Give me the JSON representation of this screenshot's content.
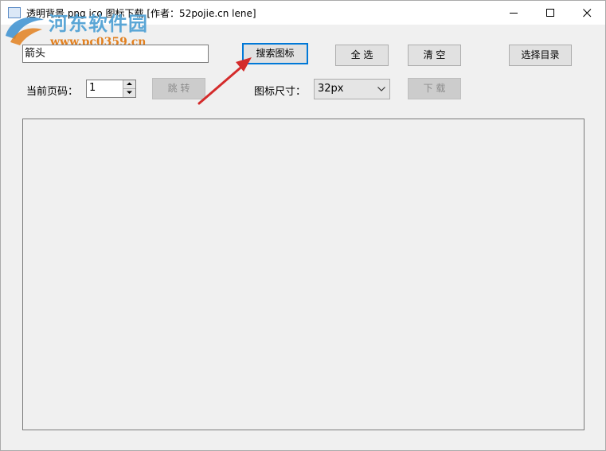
{
  "window": {
    "title": "透明背景 png ico 图标下载 [作者：52pojie.cn lene]"
  },
  "watermark": {
    "title": "河东软件园",
    "url": "www.pc0359.cn"
  },
  "search": {
    "value": "箭头"
  },
  "buttons": {
    "search": "搜索图标",
    "select_all": "全 选",
    "clear": "清 空",
    "choose_dir": "选择目录",
    "jump": "跳 转",
    "download": "下 载"
  },
  "pager": {
    "label": "当前页码：",
    "value": "1"
  },
  "icon_size": {
    "label": "图标尺寸：",
    "selected": "32px"
  },
  "colors": {
    "accent_focus": "#0078d7",
    "annotation_arrow": "#d42b2b",
    "watermark_blue": "#5aa6d6",
    "watermark_orange": "#e2801f"
  },
  "icons": [
    "app-icon",
    "minimize-icon",
    "maximize-icon",
    "close-icon",
    "spin-up-icon",
    "spin-down-icon",
    "dropdown-chevron-icon",
    "annotation-arrow"
  ]
}
